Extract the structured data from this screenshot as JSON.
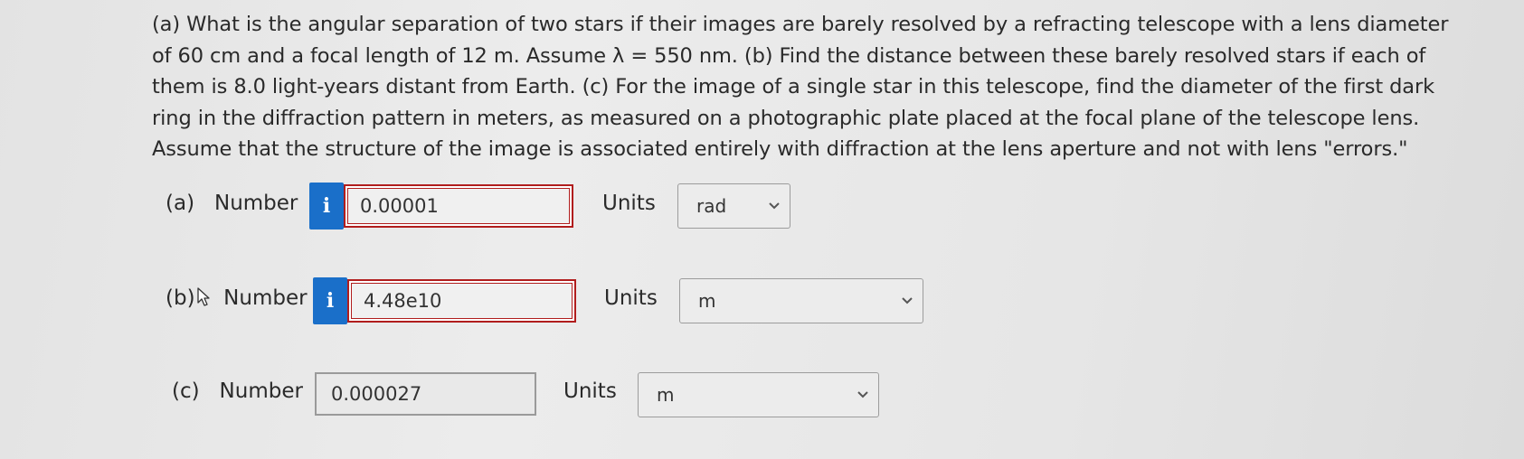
{
  "question": {
    "text": "(a) What is the angular separation of two stars if their images are barely resolved by a refracting telescope with a lens diameter of 60 cm and a focal length of 12 m. Assume λ = 550 nm. (b) Find the distance between these barely resolved stars if each of them is 8.0 light-years distant from Earth. (c) For the image of a single star in this telescope, find the diameter of the first dark ring in the diffraction pattern in meters, as measured on a photographic plate placed at the focal plane of the telescope lens. Assume that the structure of the image is associated entirely with diffraction at the lens aperture and not with lens \"errors.\""
  },
  "parts": {
    "a": {
      "label": "(a)",
      "number_label": "Number",
      "info_icon": "i",
      "value": "0.00001",
      "units_label": "Units",
      "unit": "rad"
    },
    "b": {
      "label": "(b)",
      "number_label": "Number",
      "info_icon": "i",
      "value": "4.48e10",
      "units_label": "Units",
      "unit": "m"
    },
    "c": {
      "label": "(c)",
      "number_label": "Number",
      "value": "0.000027",
      "units_label": "Units",
      "unit": "m"
    }
  },
  "colors": {
    "info_button": "#1a6fc9",
    "error_border": "#b11d1d"
  }
}
